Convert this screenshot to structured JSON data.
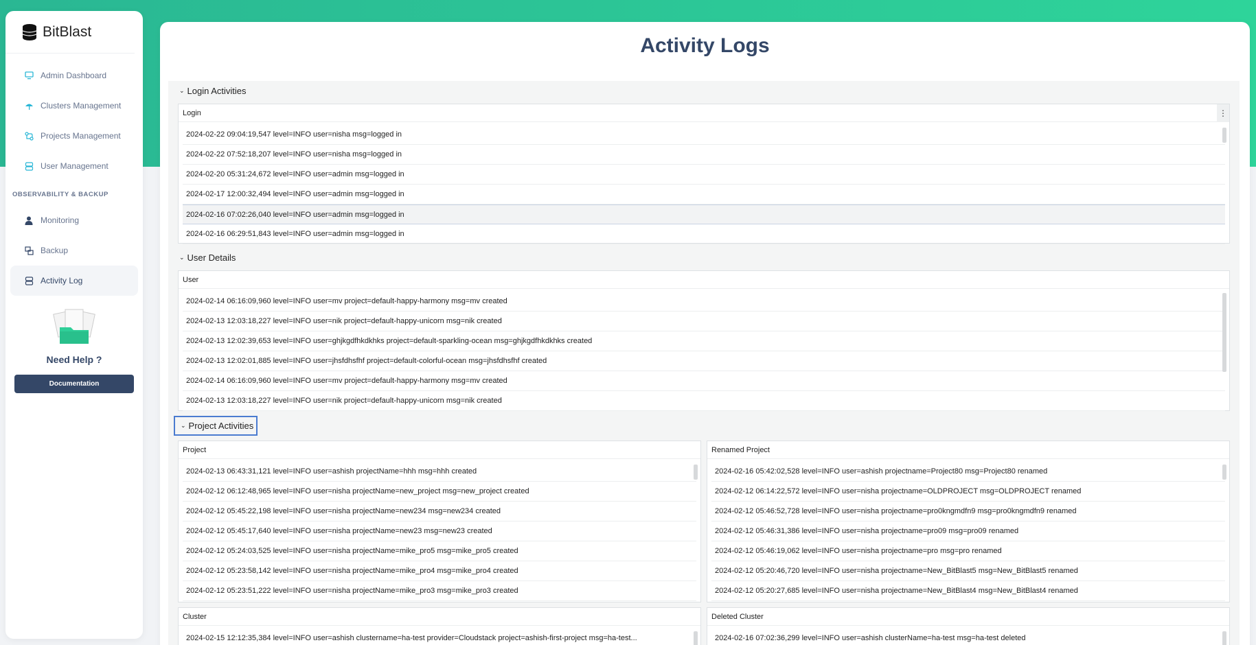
{
  "app": {
    "name": "BitBlast"
  },
  "sidebar": {
    "items": [
      {
        "label": "Admin Dashboard",
        "icon": "monitor-icon"
      },
      {
        "label": "Clusters Management",
        "icon": "umbrella-icon"
      },
      {
        "label": "Projects Management",
        "icon": "route-icon"
      },
      {
        "label": "User Management",
        "icon": "database-icon"
      }
    ],
    "section_label": "OBSERVABILITY & BACKUP",
    "items2": [
      {
        "label": "Monitoring",
        "icon": "user-icon"
      },
      {
        "label": "Backup",
        "icon": "backup-icon"
      },
      {
        "label": "Activity Log",
        "icon": "database-icon"
      }
    ],
    "help_title": "Need Help ?",
    "doc_button": "Documentation"
  },
  "page": {
    "title": "Activity Logs"
  },
  "sections": {
    "login": {
      "header": "Login Activities",
      "panel_title": "Login",
      "rows": [
        "2024-02-22 09:04:19,547 level=INFO user=nisha msg=logged in",
        "2024-02-22 07:52:18,207 level=INFO user=nisha msg=logged in",
        "2024-02-20 05:31:24,672 level=INFO user=admin msg=logged in",
        "2024-02-17 12:00:32,494 level=INFO user=admin msg=logged in",
        "2024-02-16 07:02:26,040 level=INFO user=admin msg=logged in",
        "2024-02-16 06:29:51,843 level=INFO user=admin msg=logged in"
      ]
    },
    "user": {
      "header": "User Details",
      "panel_title": "User",
      "rows": [
        "2024-02-14 06:16:09,960 level=INFO user=mv project=default-happy-harmony msg=mv created",
        "2024-02-13 12:03:18,227 level=INFO user=nik project=default-happy-unicorn msg=nik created",
        "2024-02-13 12:02:39,653 level=INFO user=ghjkgdfhkdkhks project=default-sparkling-ocean msg=ghjkgdfhkdkhks created",
        "2024-02-13 12:02:01,885 level=INFO user=jhsfdhsfhf project=default-colorful-ocean msg=jhsfdhsfhf created",
        "2024-02-14 06:16:09,960 level=INFO user=mv project=default-happy-harmony msg=mv created",
        "2024-02-13 12:03:18,227 level=INFO user=nik project=default-happy-unicorn msg=nik created"
      ]
    },
    "project": {
      "header": "Project Activities",
      "project_panel": {
        "title": "Project",
        "rows": [
          "2024-02-13 06:43:31,121 level=INFO user=ashish projectName=hhh msg=hhh created",
          "2024-02-12 06:12:48,965 level=INFO user=nisha projectName=new_project msg=new_project created",
          "2024-02-12 05:45:22,198 level=INFO user=nisha projectName=new234 msg=new234 created",
          "2024-02-12 05:45:17,640 level=INFO user=nisha projectName=new23 msg=new23 created",
          "2024-02-12 05:24:03,525 level=INFO user=nisha projectName=mike_pro5 msg=mike_pro5 created",
          "2024-02-12 05:23:58,142 level=INFO user=nisha projectName=mike_pro4 msg=mike_pro4 created",
          "2024-02-12 05:23:51,222 level=INFO user=nisha projectName=mike_pro3 msg=mike_pro3 created"
        ]
      },
      "renamed_panel": {
        "title": "Renamed Project",
        "rows": [
          "2024-02-16 05:42:02,528 level=INFO user=ashish projectname=Project80 msg=Project80 renamed",
          "2024-02-12 06:14:22,572 level=INFO user=nisha projectname=OLDPROJECT msg=OLDPROJECT renamed",
          "2024-02-12 05:46:52,728 level=INFO user=nisha projectname=pro0kngmdfn9 msg=pro0kngmdfn9 renamed",
          "2024-02-12 05:46:31,386 level=INFO user=nisha projectname=pro09 msg=pro09 renamed",
          "2024-02-12 05:46:19,062 level=INFO user=nisha projectname=pro msg=pro renamed",
          "2024-02-12 05:20:46,720 level=INFO user=nisha projectname=New_BitBlast5 msg=New_BitBlast5 renamed",
          "2024-02-12 05:20:27,685 level=INFO user=nisha projectname=New_BitBlast4 msg=New_BitBlast4 renamed"
        ]
      },
      "cluster_panel": {
        "title": "Cluster",
        "rows": [
          "2024-02-15 12:12:35,384 level=INFO user=ashish clustername=ha-test provider=Cloudstack project=ashish-first-project msg=ha-test..."
        ]
      },
      "deleted_panel": {
        "title": "Deleted Cluster",
        "rows": [
          "2024-02-16 07:02:36,299 level=INFO user=ashish clusterName=ha-test msg=ha-test deleted"
        ]
      }
    }
  }
}
